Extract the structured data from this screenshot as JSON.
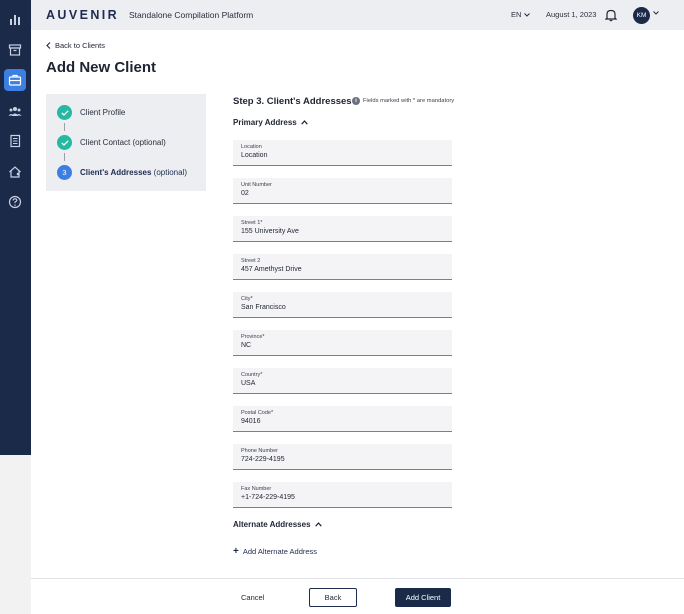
{
  "header": {
    "logo": "AUVENIR",
    "platform": "Standalone Compilation Platform",
    "language": "EN",
    "date": "August 1, 2023",
    "avatar_initials": "KM"
  },
  "sidebar": {
    "items": [
      {
        "icon": "bar-chart-icon",
        "active": false
      },
      {
        "icon": "archive-icon",
        "active": false
      },
      {
        "icon": "briefcase-icon",
        "active": true
      },
      {
        "icon": "team-icon",
        "active": false
      },
      {
        "icon": "document-icon",
        "active": false
      },
      {
        "icon": "house-person-icon",
        "active": false
      },
      {
        "icon": "help-icon",
        "active": false
      }
    ]
  },
  "main": {
    "back_label": "Back to Clients",
    "title": "Add New Client",
    "stepper": {
      "steps": [
        {
          "label": "Client Profile",
          "status": "done"
        },
        {
          "label": "Client Contact (optional)",
          "status": "done"
        },
        {
          "number": "3",
          "label": "Client's Addresses",
          "suffix": "(optional)",
          "status": "current"
        }
      ]
    },
    "form": {
      "step_title": "Step 3. Client's Addresses",
      "mandatory_note": "Fields marked with * are mandatory",
      "primary_section": "Primary Address",
      "alternate_section": "Alternate Addresses",
      "add_alternate": "Add Alternate Address",
      "fields": [
        {
          "label": "Location",
          "value": "Location"
        },
        {
          "label": "Unit Number",
          "value": "02"
        },
        {
          "label": "Street 1*",
          "value": "155 University Ave"
        },
        {
          "label": "Street 2",
          "value": "457 Amethyst Drive"
        },
        {
          "label": "City*",
          "value": "San Francisco"
        },
        {
          "label": "Province*",
          "value": "NC"
        },
        {
          "label": "Country*",
          "value": "USA"
        },
        {
          "label": "Postal Code*",
          "value": "94016"
        },
        {
          "label": "Phone Number",
          "value": "724-229-4195"
        },
        {
          "label": "Fax Number",
          "value": "+1-724-229-4195"
        }
      ]
    }
  },
  "footer": {
    "cancel": "Cancel",
    "back": "Back",
    "add_client": "Add Client"
  },
  "colors": {
    "sidebar": "#1c2a4a",
    "accent": "#3d7fe0",
    "success": "#26b8a0"
  }
}
